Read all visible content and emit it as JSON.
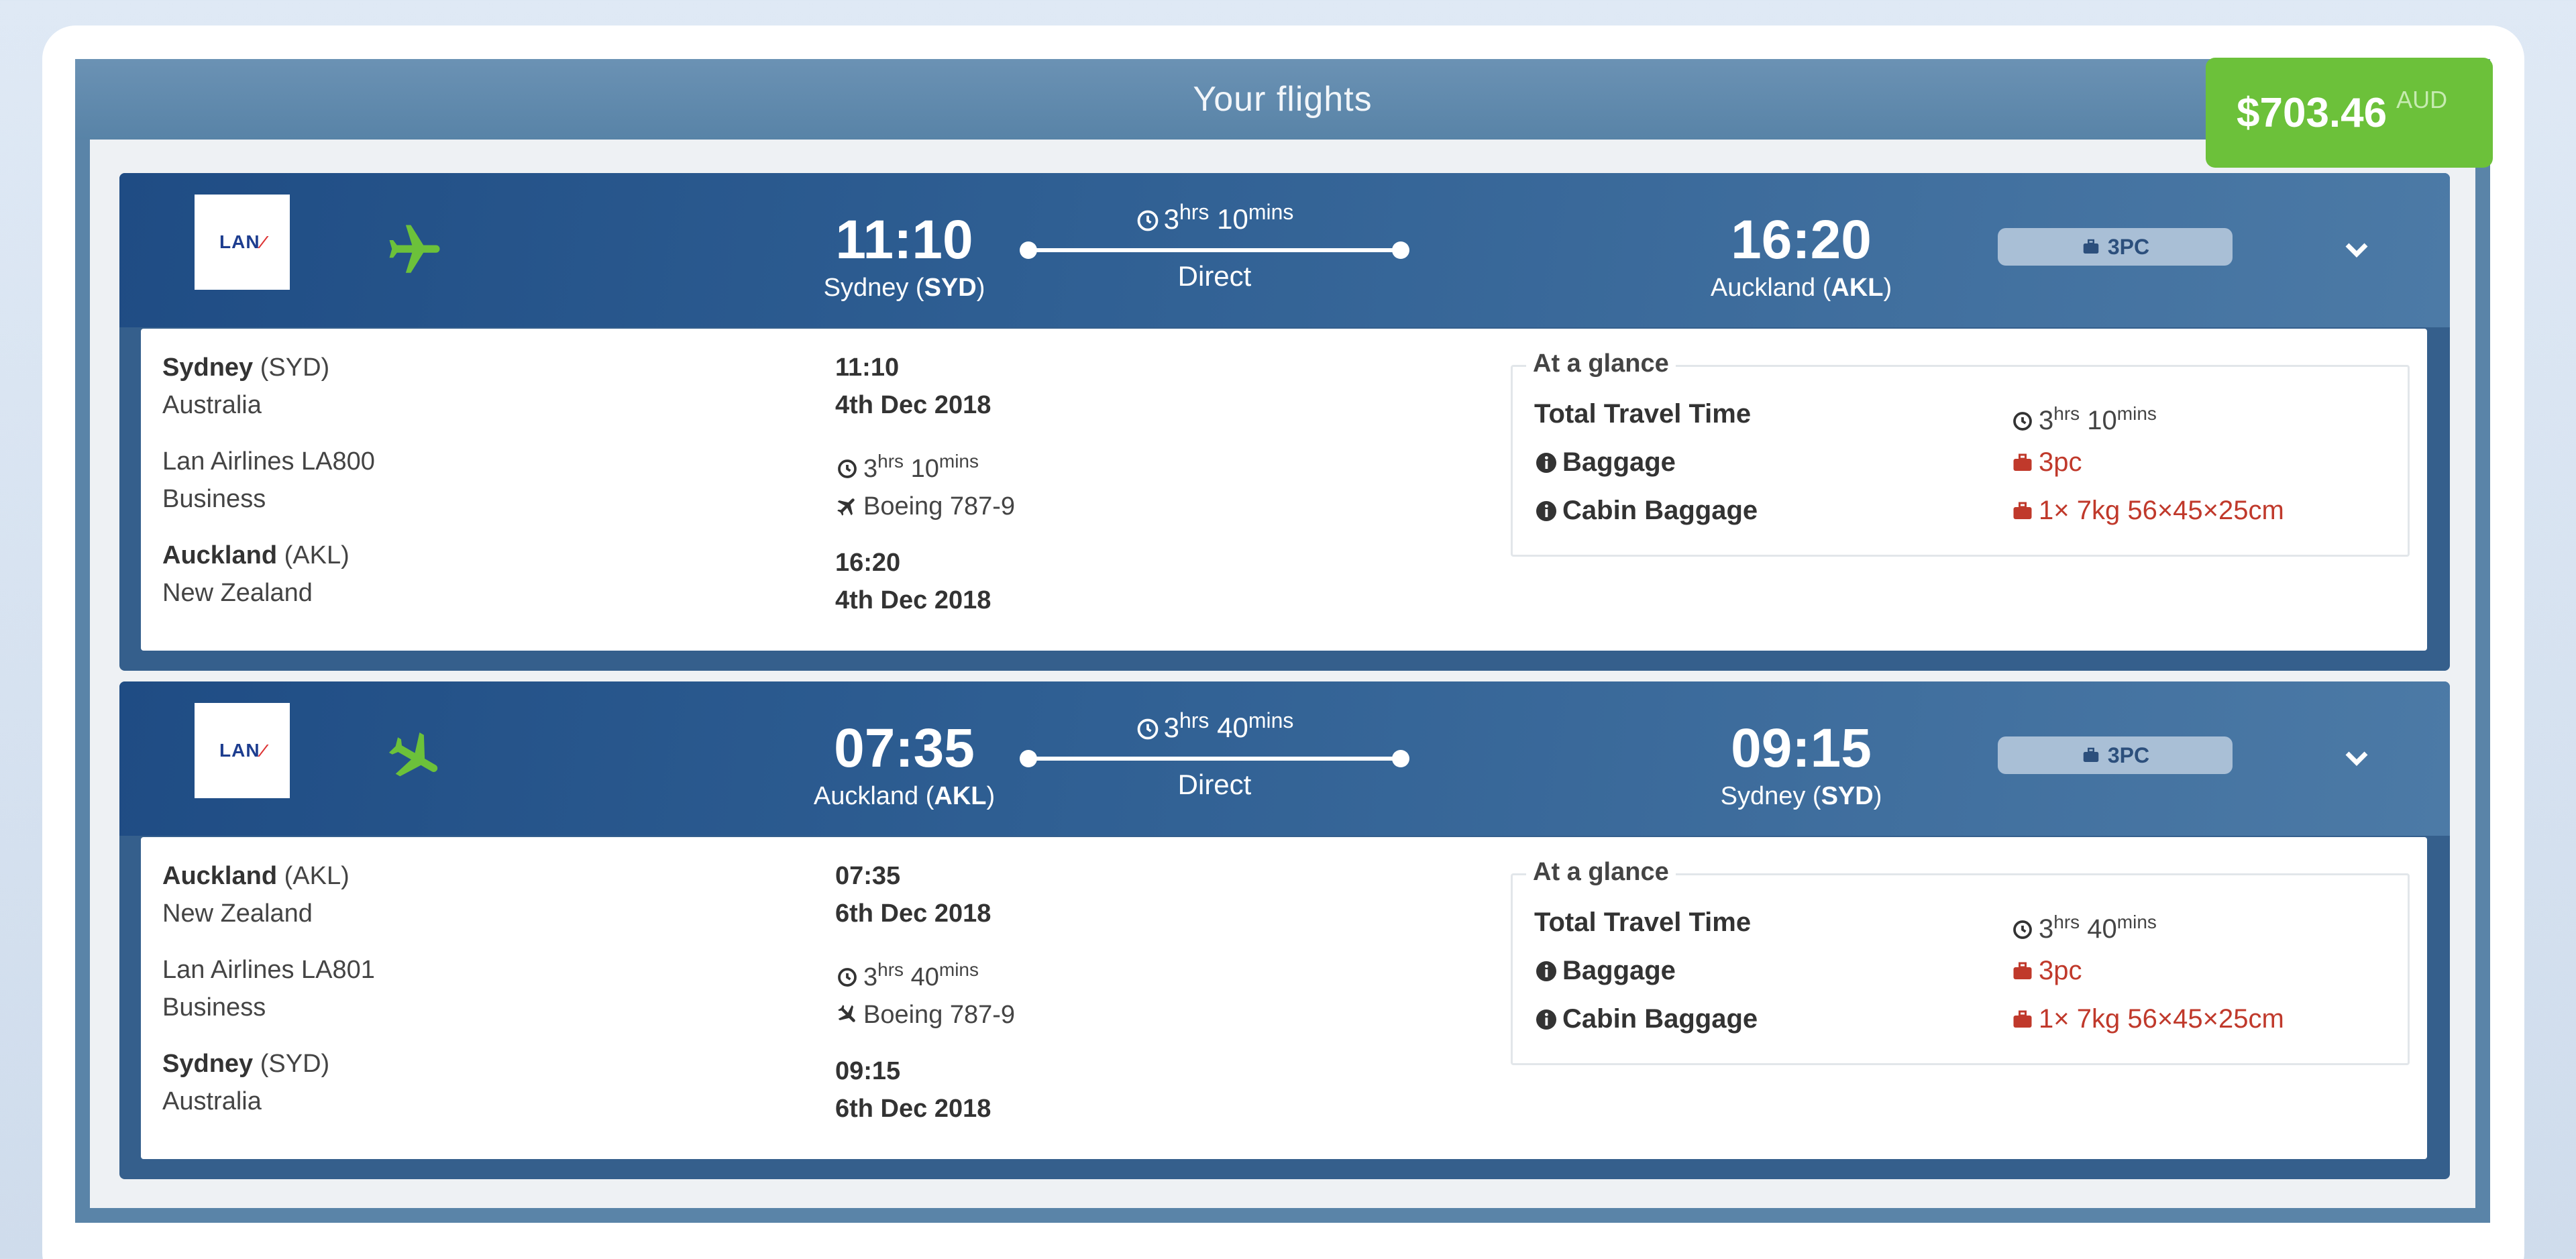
{
  "panel": {
    "title": "Your flights"
  },
  "price": {
    "amount": "$703.46",
    "currency": "AUD"
  },
  "colors": {
    "accent_green": "#6cc13a",
    "header_blue": "#2f5f93",
    "baggage_red": "#c0392b"
  },
  "legs": [
    {
      "airline_logo_text": "LAN",
      "departure_time": "11:10",
      "departure_city": "Sydney",
      "departure_code": "SYD",
      "arrival_time": "16:20",
      "arrival_city": "Auckland",
      "arrival_code": "AKL",
      "duration_hours": "3",
      "duration_minutes": "10",
      "hrs_label": "hrs",
      "mins_label": "mins",
      "stops": "Direct",
      "baggage_pill": "3PC",
      "details": {
        "from_city": "Sydney",
        "from_code": "(SYD)",
        "from_country": "Australia",
        "flight": "Lan Airlines LA800",
        "cabin": "Business",
        "to_city": "Auckland",
        "to_code": "(AKL)",
        "to_country": "New Zealand",
        "dep_time": "11:10",
        "dep_date": "4th Dec 2018",
        "aircraft": "Boeing 787-9",
        "arr_time": "16:20",
        "arr_date": "4th Dec 2018"
      },
      "glance": {
        "title": "At a glance",
        "travel_time_label": "Total Travel Time",
        "baggage_label": "Baggage",
        "baggage_value": "3pc",
        "cabin_label": "Cabin Baggage",
        "cabin_value": "1× 7kg 56×45×25cm"
      }
    },
    {
      "airline_logo_text": "LAN",
      "departure_time": "07:35",
      "departure_city": "Auckland",
      "departure_code": "AKL",
      "arrival_time": "09:15",
      "arrival_city": "Sydney",
      "arrival_code": "SYD",
      "duration_hours": "3",
      "duration_minutes": "40",
      "hrs_label": "hrs",
      "mins_label": "mins",
      "stops": "Direct",
      "baggage_pill": "3PC",
      "details": {
        "from_city": "Auckland",
        "from_code": "(AKL)",
        "from_country": "New Zealand",
        "flight": "Lan Airlines LA801",
        "cabin": "Business",
        "to_city": "Sydney",
        "to_code": "(SYD)",
        "to_country": "Australia",
        "dep_time": "07:35",
        "dep_date": "6th Dec 2018",
        "aircraft": "Boeing 787-9",
        "arr_time": "09:15",
        "arr_date": "6th Dec 2018"
      },
      "glance": {
        "title": "At a glance",
        "travel_time_label": "Total Travel Time",
        "baggage_label": "Baggage",
        "baggage_value": "3pc",
        "cabin_label": "Cabin Baggage",
        "cabin_value": "1× 7kg 56×45×25cm"
      }
    }
  ]
}
